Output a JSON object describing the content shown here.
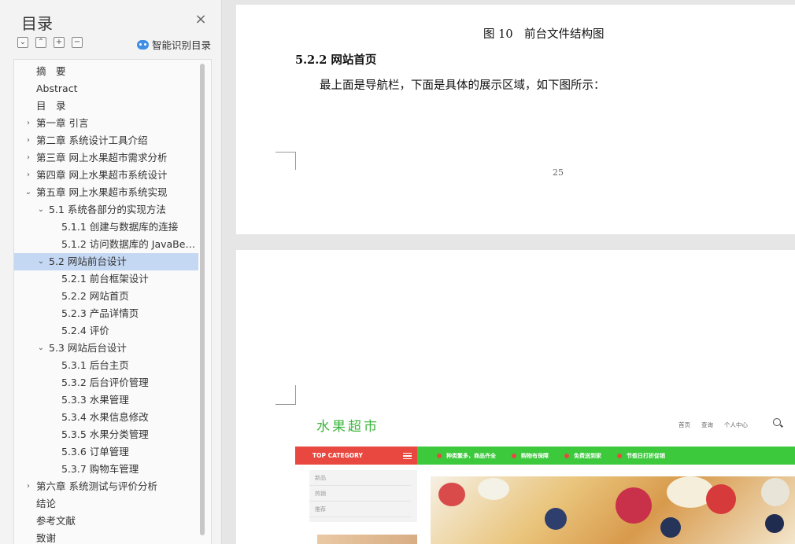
{
  "sidebar": {
    "title": "目录",
    "close_label": "×",
    "tools": [
      {
        "icon": "collapse-down-icon",
        "glyph": "⌄"
      },
      {
        "icon": "collapse-up-icon",
        "glyph": "⌃"
      },
      {
        "icon": "expand-plus-icon",
        "glyph": "+"
      },
      {
        "icon": "collapse-minus-icon",
        "glyph": "−"
      }
    ],
    "ai_label": "智能识别目录",
    "toc": [
      {
        "label": "摘　要",
        "level": 0,
        "caret": ""
      },
      {
        "label": "Abstract",
        "level": 0,
        "caret": ""
      },
      {
        "label": "目　录",
        "level": 0,
        "caret": ""
      },
      {
        "label": "第一章  引言",
        "level": 0,
        "caret": "›"
      },
      {
        "label": "第二章  系统设计工具介绍",
        "level": 0,
        "caret": "›"
      },
      {
        "label": "第三章  网上水果超市需求分析",
        "level": 0,
        "caret": "›"
      },
      {
        "label": "第四章  网上水果超市系统设计",
        "level": 0,
        "caret": "›"
      },
      {
        "label": "第五章  网上水果超市系统实现",
        "level": 0,
        "caret": "⌄"
      },
      {
        "label": "5.1  系统各部分的实现方法",
        "level": 1,
        "caret": "⌄"
      },
      {
        "label": "5.1.1  创建与数据库的连接",
        "level": 2,
        "caret": ""
      },
      {
        "label": "5.1.2  访问数据库的 JavaBean...",
        "level": 2,
        "caret": ""
      },
      {
        "label": "5.2  网站前台设计",
        "level": 1,
        "caret": "⌄",
        "active": true
      },
      {
        "label": "5.2.1 前台框架设计",
        "level": 2,
        "caret": ""
      },
      {
        "label": "5.2.2  网站首页",
        "level": 2,
        "caret": ""
      },
      {
        "label": "5.2.3  产品详情页",
        "level": 2,
        "caret": ""
      },
      {
        "label": "5.2.4  评价",
        "level": 2,
        "caret": ""
      },
      {
        "label": "5.3 网站后台设计",
        "level": 1,
        "caret": "⌄"
      },
      {
        "label": "5.3.1  后台主页",
        "level": 2,
        "caret": ""
      },
      {
        "label": "5.3.2  后台评价管理",
        "level": 2,
        "caret": ""
      },
      {
        "label": "5.3.3  水果管理",
        "level": 2,
        "caret": ""
      },
      {
        "label": "5.3.4 水果信息修改",
        "level": 2,
        "caret": ""
      },
      {
        "label": "5.3.5  水果分类管理",
        "level": 2,
        "caret": ""
      },
      {
        "label": "5.3.6  订单管理",
        "level": 2,
        "caret": ""
      },
      {
        "label": "5.3.7  购物车管理",
        "level": 2,
        "caret": ""
      },
      {
        "label": "第六章  系统测试与评价分析",
        "level": 0,
        "caret": "›"
      },
      {
        "label": "结论",
        "level": 0,
        "caret": ""
      },
      {
        "label": "参考文献",
        "level": 0,
        "caret": ""
      },
      {
        "label": "致谢",
        "level": 0,
        "caret": ""
      }
    ]
  },
  "document": {
    "figure_caption": "图 10　前台文件结构图",
    "section_heading": "5.2.2  网站首页",
    "paragraph": "最上面是导航栏，下面是具体的展示区域，如下图所示：",
    "page_number": "25"
  },
  "website": {
    "logo": "水果超市",
    "nav": [
      "首页",
      "查询",
      "个人中心"
    ],
    "category_label": "TOP CATEGORY",
    "promos": [
      "种类繁多，商品齐全",
      "购物有保障",
      "免费送到家",
      "节假日打折促销"
    ],
    "side_links": [
      "新品",
      "热销",
      "推荐"
    ]
  },
  "colors": {
    "active_toc": "#c5d8f3",
    "site_green": "#3cc93c",
    "site_red": "#e8483f",
    "ai_blue": "#3f8ee6"
  }
}
